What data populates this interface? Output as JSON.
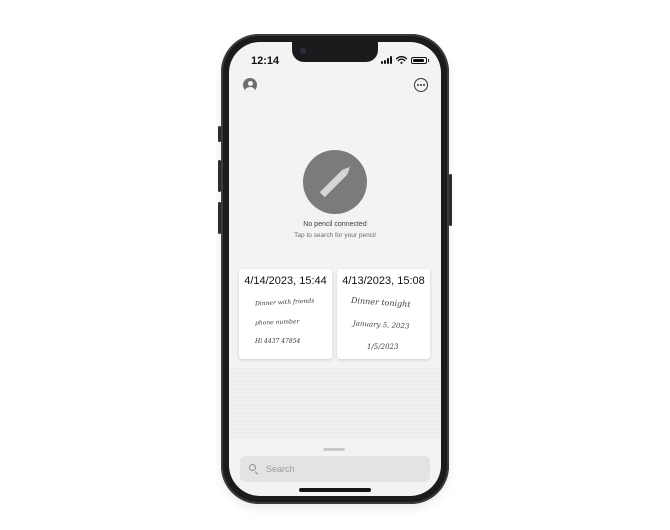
{
  "status_bar": {
    "time": "12:14"
  },
  "header": {
    "profile_icon": "person-circle-icon",
    "more_icon": "ellipsis-circle-icon"
  },
  "pencil_status": {
    "icon": "pencil-icon",
    "title": "No pencil connected",
    "subtitle": "Tap to search for your pencil"
  },
  "notes": [
    {
      "date": "4/14/2023, 15:44",
      "handwriting": [
        "Dinner with friends",
        "phone number",
        "Hi 4437 47854"
      ]
    },
    {
      "date": "4/13/2023, 15:08",
      "handwriting": [
        "Dinner tonight",
        "January 5, 2023",
        "1/5/2023"
      ]
    }
  ],
  "search": {
    "placeholder": "Search"
  },
  "colors": {
    "screen_bg": "#f3f3f4",
    "accent_circle": "#7b7b7d",
    "frame": "#1b1b1d"
  }
}
